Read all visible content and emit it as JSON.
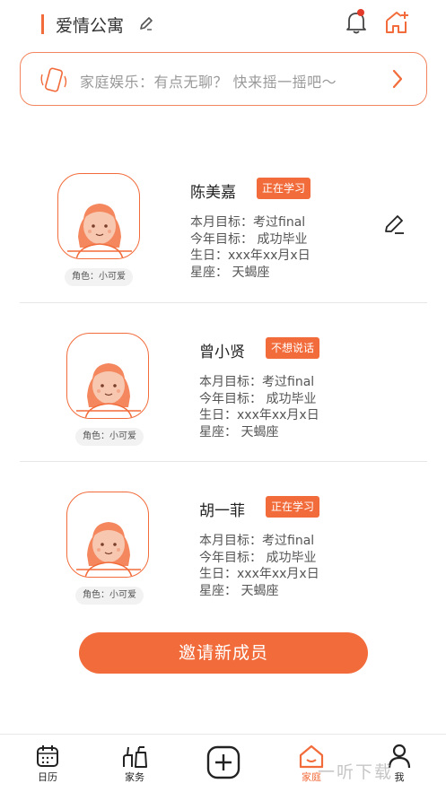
{
  "header": {
    "title": "爱情公寓",
    "edit_icon": "pencil-icon",
    "bell_icon": "bell-icon",
    "home_add_icon": "home-add-icon"
  },
  "banner": {
    "icon": "shake-phone-icon",
    "text": "家庭娱乐：有点无聊？ 快来摇一摇吧～",
    "chevron_icon": "chevron-right-icon"
  },
  "members": [
    {
      "name": "陈美嘉",
      "status": "正在学习",
      "role": "角色：小可爱",
      "monthly_goal": "本月目标：考过final",
      "yearly_goal": "今年目标：  成功毕业",
      "birthday": "生日：xxx年xx月x日",
      "zodiac": "星座：  天蝎座",
      "editable": true
    },
    {
      "name": "曾小贤",
      "status": "不想说话",
      "role": "角色：小可爱",
      "monthly_goal": "本月目标：考过final",
      "yearly_goal": "今年目标：  成功毕业",
      "birthday": "生日：xxx年xx月x日",
      "zodiac": "星座：  天蝎座",
      "editable": false
    },
    {
      "name": "胡一菲",
      "status": "正在学习",
      "role": "角色：小可爱",
      "monthly_goal": "本月目标：考过final",
      "yearly_goal": "今年目标：  成功毕业",
      "birthday": "生日：xxx年xx月x日",
      "zodiac": "星座：  天蝎座",
      "editable": false
    }
  ],
  "invite_button": "邀请新成员",
  "tabbar": {
    "items": [
      {
        "label": "日历",
        "icon": "calendar-icon"
      },
      {
        "label": "家务",
        "icon": "chores-icon"
      },
      {
        "label": "",
        "icon": "plus-icon"
      },
      {
        "label": "家庭",
        "icon": "home-icon",
        "active": true
      },
      {
        "label": "我",
        "icon": "person-icon"
      }
    ]
  },
  "watermark": "一听下载",
  "colors": {
    "accent": "#f26b3a",
    "avatar_skin": "#f8c7b0",
    "avatar_hair": "#f4875d",
    "divider": "#e6e6e6"
  }
}
